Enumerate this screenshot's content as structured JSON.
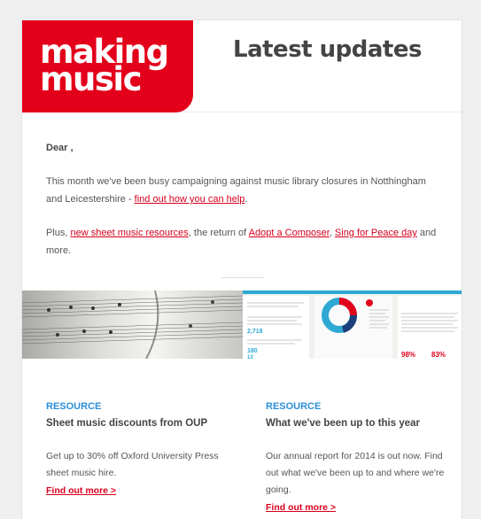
{
  "header": {
    "logo_line1": "making",
    "logo_line2": "music",
    "title": "Latest updates"
  },
  "intro": {
    "greeting": "Dear ,",
    "para1_text": "This month we've been busy campaigning against music library closures in Notthingham and Leicestershire - ",
    "para1_link": "find out how you can help",
    "para1_end": ".",
    "para2_start": "Plus, ",
    "para2_link1": "new sheet music resources",
    "para2_mid1": ", the return of ",
    "para2_link2": "Adopt a Composer",
    "para2_mid2": ", ",
    "para2_link3": "Sing for Peace day",
    "para2_end": " and more."
  },
  "banner": {
    "report_num1": "2,718",
    "report_num2": "180",
    "report_num3": "13",
    "pct1": "98%",
    "pct2": "83%"
  },
  "columns": [
    {
      "tag": "RESOURCE",
      "title": "Sheet music discounts from OUP",
      "body": "Get up to 30% off Oxford University Press sheet music hire.",
      "link": "Find out more >"
    },
    {
      "tag": "RESOURCE",
      "title": "What we've been up to this year",
      "body": "Our annual report for 2014 is out now. Find out what we've been up to and where we're going.",
      "link": "Find out more >"
    }
  ],
  "colors": {
    "brand_red": "#e3001b",
    "link_red": "#d6001c",
    "tag_blue": "#2b8fd6"
  }
}
